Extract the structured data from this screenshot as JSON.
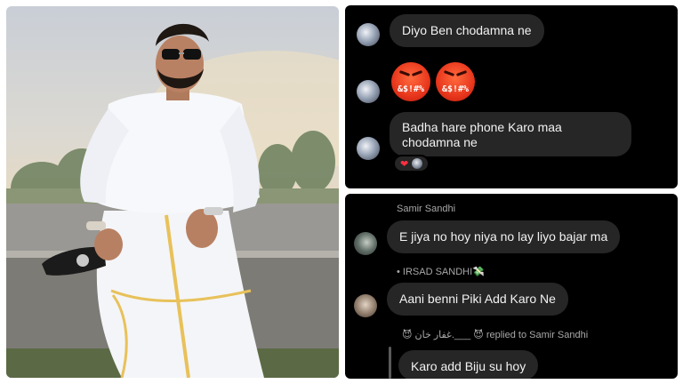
{
  "chat_top": {
    "messages": [
      {
        "text": "Diyo Ben chodamna ne"
      },
      {
        "emojis": [
          {
            "name": "cursing-face-emoji",
            "symbols": "&$!#%"
          },
          {
            "name": "cursing-face-emoji",
            "symbols": "&$!#%"
          }
        ]
      },
      {
        "text": "Badha hare phone Karo maa chodamna ne",
        "reactions": [
          "heart-icon",
          "reactor-avatar"
        ]
      }
    ],
    "heart": "❤"
  },
  "chat_bottom": {
    "messages": [
      {
        "sender": "Samir Sandhi",
        "text": "E jiya no hoy niya no lay liyo bajar ma"
      },
      {
        "sender": "• IRSAD SANDHI💸",
        "text": "Aani benni Piki Add Karo Ne"
      },
      {
        "reply_prefix_emoji": "😈",
        "reply_name": "غفار خان.___",
        "reply_suffix_emoji": "😈",
        "reply_text": "replied to Samir Sandhi",
        "text": "Karo add Biju su hoy"
      }
    ]
  },
  "colors": {
    "panel_bg": "#000000",
    "bubble_bg": "#262626",
    "bubble_text": "#f2f2f2",
    "meta_text": "#a8a8a8",
    "heart": "#ff3040"
  }
}
